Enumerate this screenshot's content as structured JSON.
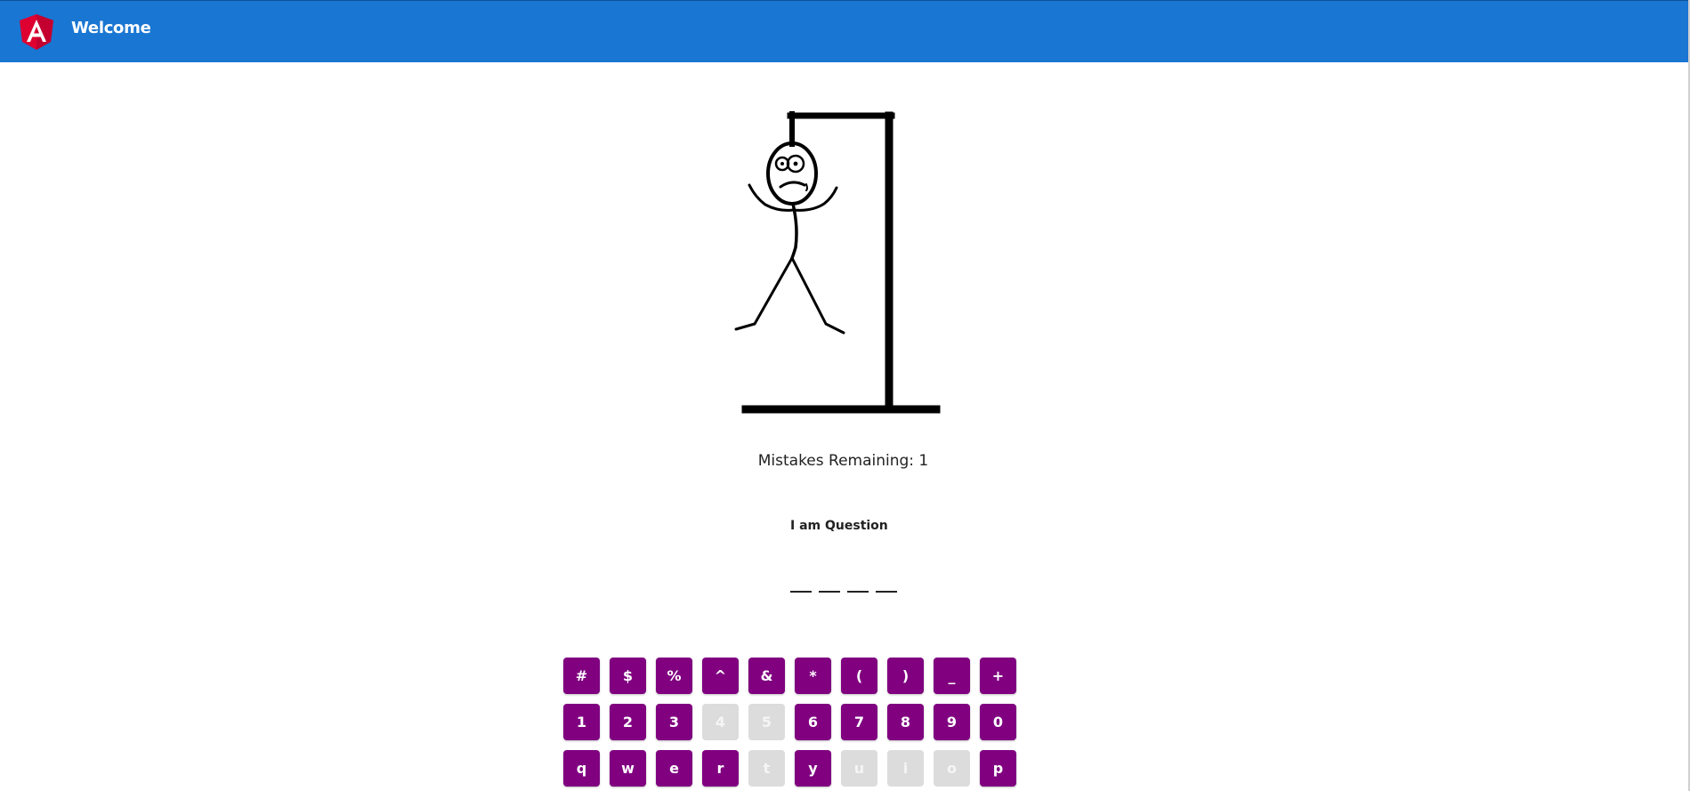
{
  "header": {
    "title": "Welcome",
    "background": "#1976d2",
    "logo_icon": "angular-logo-icon"
  },
  "game": {
    "mistakes_remaining": "Mistakes Remaining: 1",
    "question": "I am Question",
    "word_length": 4,
    "revealed_letters": [
      "",
      "",
      "",
      ""
    ]
  },
  "keyboard": {
    "active_color": "#800080",
    "disabled_color": "#dcdcdc",
    "rows": [
      [
        {
          "label": "#",
          "disabled": false
        },
        {
          "label": "$",
          "disabled": false
        },
        {
          "label": "%",
          "disabled": false
        },
        {
          "label": "^",
          "disabled": false
        },
        {
          "label": "&",
          "disabled": false
        },
        {
          "label": "*",
          "disabled": false
        },
        {
          "label": "(",
          "disabled": false
        },
        {
          "label": ")",
          "disabled": false
        },
        {
          "label": "_",
          "disabled": false
        },
        {
          "label": "+",
          "disabled": false
        }
      ],
      [
        {
          "label": "1",
          "disabled": false
        },
        {
          "label": "2",
          "disabled": false
        },
        {
          "label": "3",
          "disabled": false
        },
        {
          "label": "4",
          "disabled": true
        },
        {
          "label": "5",
          "disabled": true
        },
        {
          "label": "6",
          "disabled": false
        },
        {
          "label": "7",
          "disabled": false
        },
        {
          "label": "8",
          "disabled": false
        },
        {
          "label": "9",
          "disabled": false
        },
        {
          "label": "0",
          "disabled": false
        }
      ],
      [
        {
          "label": "q",
          "disabled": false
        },
        {
          "label": "w",
          "disabled": false
        },
        {
          "label": "e",
          "disabled": false
        },
        {
          "label": "r",
          "disabled": false
        },
        {
          "label": "t",
          "disabled": true
        },
        {
          "label": "y",
          "disabled": false
        },
        {
          "label": "u",
          "disabled": true
        },
        {
          "label": "i",
          "disabled": true
        },
        {
          "label": "o",
          "disabled": true
        },
        {
          "label": "p",
          "disabled": false
        }
      ]
    ]
  }
}
